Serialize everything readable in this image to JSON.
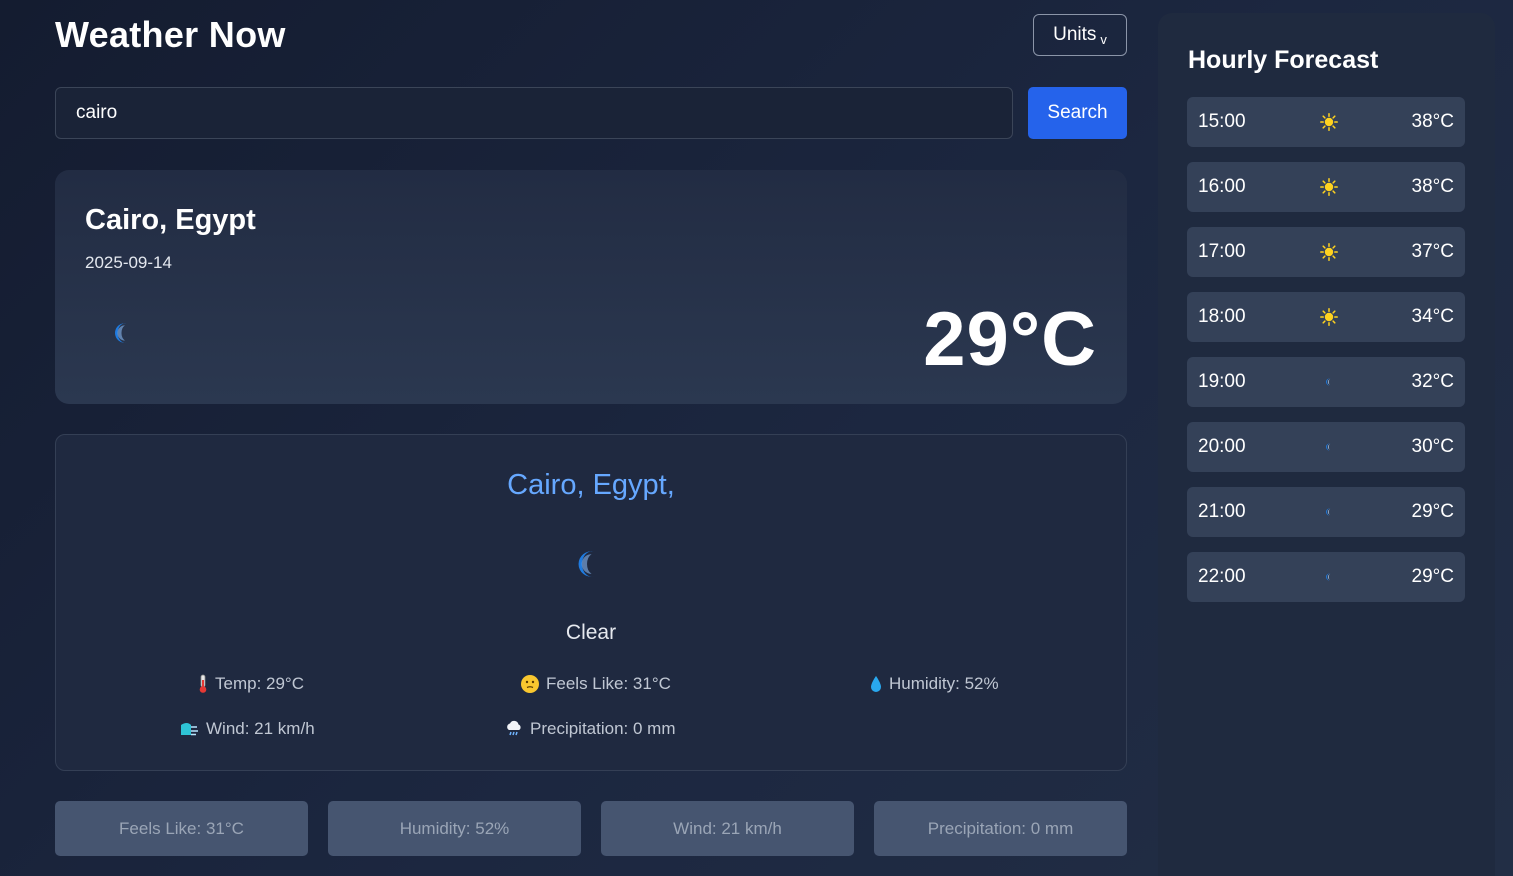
{
  "header": {
    "title": "Weather Now",
    "units_label": "Units"
  },
  "search": {
    "value": "cairo",
    "button_label": "Search"
  },
  "current": {
    "city": "Cairo, Egypt",
    "date": "2025-09-14",
    "icon": "moon-icon",
    "temperature": "29°C"
  },
  "details": {
    "city": "Cairo, Egypt,",
    "icon": "moon-icon",
    "condition": "Clear",
    "temp": "Temp: 29°C",
    "feels_like": "Feels Like: 31°C",
    "humidity": "Humidity: 52%",
    "wind": "Wind: 21 km/h",
    "precipitation": "Precipitation: 0 mm"
  },
  "summary": [
    "Feels Like: 31°C",
    "Humidity: 52%",
    "Wind: 21 km/h",
    "Precipitation: 0 mm"
  ],
  "hourly": {
    "title": "Hourly Forecast",
    "items": [
      {
        "time": "15:00",
        "icon": "sun-icon",
        "temp": "38°C"
      },
      {
        "time": "16:00",
        "icon": "sun-icon",
        "temp": "38°C"
      },
      {
        "time": "17:00",
        "icon": "sun-icon",
        "temp": "37°C"
      },
      {
        "time": "18:00",
        "icon": "sun-icon",
        "temp": "34°C"
      },
      {
        "time": "19:00",
        "icon": "moon-icon",
        "temp": "32°C"
      },
      {
        "time": "20:00",
        "icon": "moon-icon",
        "temp": "30°C"
      },
      {
        "time": "21:00",
        "icon": "moon-icon",
        "temp": "29°C"
      },
      {
        "time": "22:00",
        "icon": "moon-icon",
        "temp": "29°C"
      }
    ]
  },
  "colors": {
    "accent": "#2563eb",
    "city_highlight": "#66a8ff",
    "sun": "#ffd21f",
    "moon": "#1f7be0"
  }
}
